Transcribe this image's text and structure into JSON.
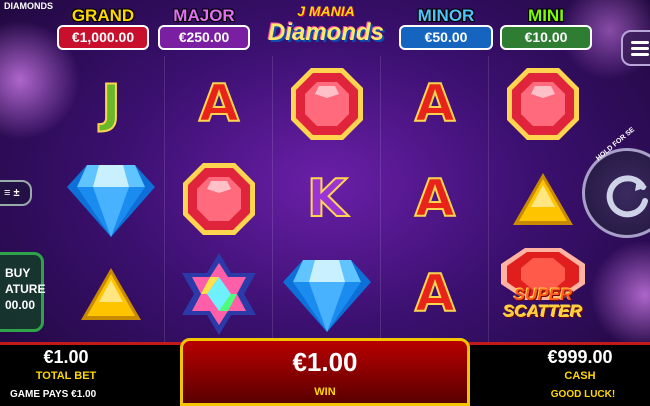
{
  "window": {
    "title_fragment": "DIAMONDS"
  },
  "logo": {
    "small": "J MANIA",
    "big": "Diamonds"
  },
  "jackpots": [
    {
      "label": "GRAND",
      "value": "€1,000.00",
      "color": "#c8102e"
    },
    {
      "label": "MAJOR",
      "value": "€250.00",
      "color": "#7b1fa2"
    },
    {
      "label": "MINOR",
      "value": "€50.00",
      "color": "#1565c0"
    },
    {
      "label": "MINI",
      "value": "€10.00",
      "color": "#2e7d32"
    }
  ],
  "reels": [
    [
      "letter-j",
      "diamond-blue",
      "triangle-gold"
    ],
    [
      "letter-a",
      "gem-red-octagon",
      "star-gem-rainbow"
    ],
    [
      "gem-red-octagon",
      "letter-k",
      "diamond-blue"
    ],
    [
      "letter-a",
      "letter-a",
      "letter-a"
    ],
    [
      "gem-red-octagon",
      "triangle-gold",
      "super-scatter"
    ]
  ],
  "scatter": {
    "line1": "SUPER",
    "line2": "SCATTER"
  },
  "controls": {
    "bet_stepper": "≡ ±",
    "buy_feature_line1": "BUY",
    "buy_feature_line2": "ATURE",
    "buy_feature_line3": "00.00",
    "spin_hint": "HOLD FOR SE"
  },
  "footer": {
    "total_bet_value": "€1.00",
    "total_bet_label": "TOTAL BET",
    "game_pays": "GAME PAYS €1.00",
    "win_value": "€1.00",
    "win_label": "WIN",
    "cash_value": "€999.00",
    "cash_label": "CASH",
    "status": "GOOD LUCK!"
  }
}
